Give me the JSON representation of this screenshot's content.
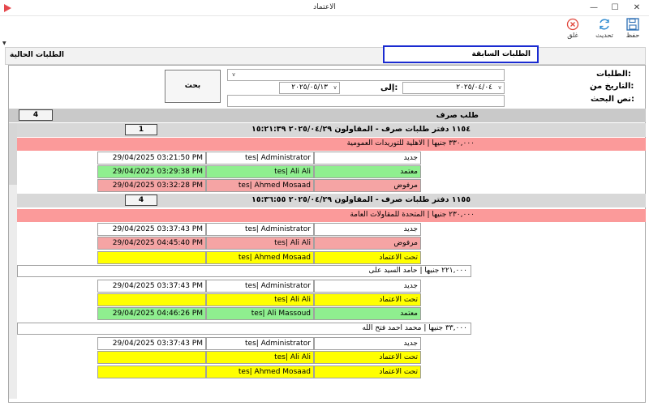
{
  "window": {
    "title": "الاعتماد",
    "minimize": "—",
    "maximize": "☐",
    "close": "✕"
  },
  "toolbar": {
    "save": "حفظ",
    "refresh": "تحديث",
    "close": "غلق"
  },
  "tabs": {
    "previous": "الطلبات السابقة",
    "current": "الطلبات الحالية"
  },
  "filters": {
    "requests_label": "الطلبات:",
    "date_from_label": "التاريخ من:",
    "to_label": "إلى:",
    "search_text_label": "نص البحث:",
    "date_from": "٢٠٢٥/٠٤/٠٤",
    "date_to": "٢٠٢٥/٠٥/١٣",
    "search_button": "بحث"
  },
  "groups": {
    "type_title": "طلب صرف",
    "type_count": "4",
    "g1": {
      "header": "١١٥٤ دفتر طلبات صرف - المقاولون ٢٠٢٥/٠٤/٢٩ ١٥:٢١:٣٩",
      "count": "1",
      "detail": "٣٣٠,٠٠٠ جنيها | الاهلية للتوريدات العمومية",
      "rows": [
        {
          "date": "29/04/2025 03:21:50 PM",
          "user": "tes| Administrator",
          "status": "جديد"
        },
        {
          "date": "29/04/2025 03:29:38 PM",
          "user": "tes| Ali Ali",
          "status": "معتمد"
        },
        {
          "date": "29/04/2025 03:32:28 PM",
          "user": "tes| Ahmed Mosaad",
          "status": "مرفوض"
        }
      ]
    },
    "g2": {
      "header": "١١٥٥ دفتر طلبات صرف - المقاولون ٢٠٢٥/٠٤/٢٩ ١٥:٣٦:٥٥",
      "count": "4",
      "detail": "٢٣٠,٠٠٠ جنيها | المتحدة للمقاولات العامة",
      "rows": [
        {
          "date": "29/04/2025 03:37:43 PM",
          "user": "tes| Administrator",
          "status": "جديد"
        },
        {
          "date": "29/04/2025 04:45:40 PM",
          "user": "tes| Ali Ali",
          "status": "مرفوض"
        },
        {
          "date": "",
          "user": "tes| Ahmed Mosaad",
          "status": "تحت الاعتماد"
        }
      ],
      "detail2": "٢٢١,٠٠٠ جنيها | حامد السيد على",
      "rows2": [
        {
          "date": "29/04/2025 03:37:43 PM",
          "user": "tes| Administrator",
          "status": "جديد"
        },
        {
          "date": "",
          "user": "tes| Ali Ali",
          "status": "تحت الاعتماد"
        },
        {
          "date": "29/04/2025 04:46:26 PM",
          "user": "tes| Ali Massoud",
          "status": "معتمد"
        }
      ],
      "detail3": "٣٣,٠٠٠ جنيها | محمد احمد فتح الله",
      "rows3": [
        {
          "date": "29/04/2025 03:37:43 PM",
          "user": "tes| Administrator",
          "status": "جديد"
        },
        {
          "date": "",
          "user": "tes| Ali Ali",
          "status": "تحت الاعتماد"
        },
        {
          "date": "",
          "user": "tes| Ahmed Mosaad",
          "status": "تحت الاعتماد"
        }
      ]
    }
  },
  "colors": {
    "approved": "#8fef8f",
    "rejected": "#f5a4a4",
    "pending": "#ffff00",
    "selected_tab_border": "#1a2bd1"
  }
}
